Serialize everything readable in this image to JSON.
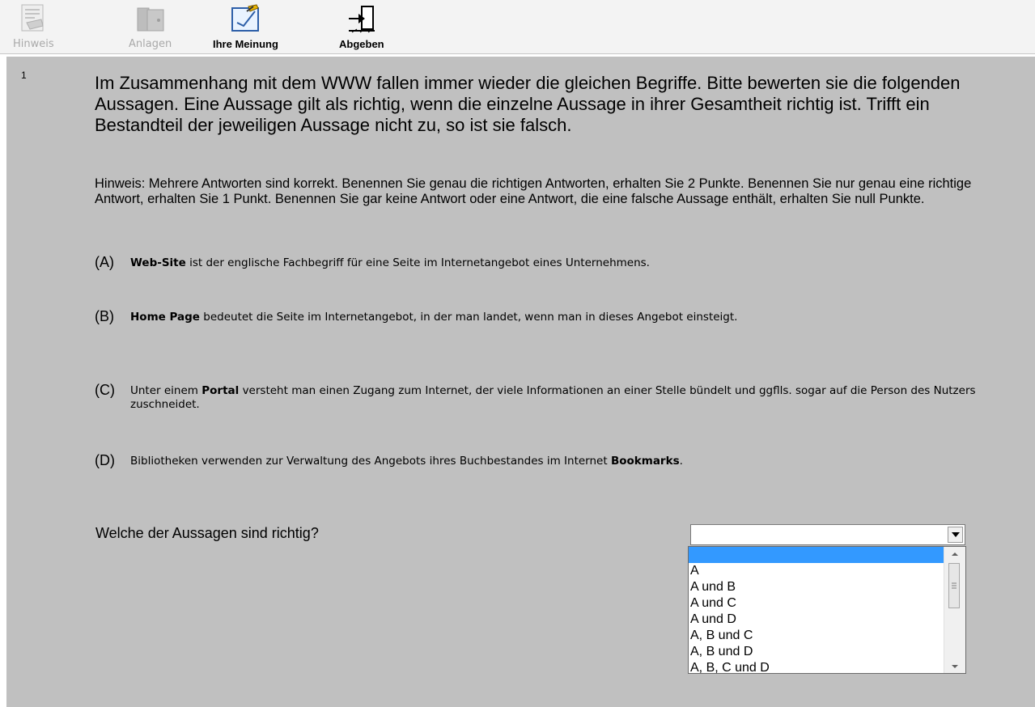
{
  "toolbar": {
    "items": [
      {
        "label": "Hinweis",
        "icon": "hint-document-icon",
        "enabled": false
      },
      {
        "label": "Anlagen",
        "icon": "attachments-folder-icon",
        "enabled": false
      },
      {
        "label": "Ihre Meinung",
        "icon": "feedback-pencil-icon",
        "enabled": true
      },
      {
        "label": "Abgeben",
        "icon": "exit-door-icon",
        "enabled": true
      }
    ]
  },
  "question": {
    "number": "1",
    "text": "Im Zusammenhang mit dem WWW fallen immer wieder die gleichen Begriffe. Bitte bewerten sie die folgenden Aussagen. Eine Aussage gilt als richtig, wenn die einzelne Aussage in ihrer Gesamtheit richtig ist. Trifft ein Bestandteil der jeweiligen Aussage nicht zu, so ist sie falsch.",
    "hint": "Hinweis: Mehrere Antworten sind korrekt. Benennen Sie genau die richtigen Antworten, erhalten Sie 2 Punkte. Benennen Sie nur genau eine richtige Antwort, erhalten Sie 1 Punkt. Benennen Sie gar keine Antwort oder eine Antwort, die eine falsche Aussage enthält, erhalten Sie null Punkte."
  },
  "options": [
    {
      "letter": "(A)",
      "pre": "",
      "bold": "Web-Site",
      "post": " ist der englische Fachbegriff für eine Seite im Internetangebot eines Unternehmens."
    },
    {
      "letter": "(B)",
      "pre": "",
      "bold": "Home Page",
      "post": " bedeutet die Seite im Internetangebot, in der man landet, wenn man in dieses Angebot einsteigt."
    },
    {
      "letter": "(C)",
      "pre": "Unter einem ",
      "bold": "Portal",
      "post": " versteht man einen Zugang zum Internet, der viele Informationen an einer Stelle bündelt und ggflls. sogar auf die Person des Nutzers zuschneidet."
    },
    {
      "letter": "(D)",
      "pre": "Bibliotheken verwenden zur Verwaltung des Angebots ihres Buchbestandes im Internet ",
      "bold": "Bookmarks",
      "post": "."
    }
  ],
  "answer": {
    "prompt": "Welche der  Aussagen sind richtig?",
    "selected_value": "",
    "dropdown_options": [
      "",
      "A",
      "A und B",
      "A und C",
      "A und D",
      "A, B und C",
      "A, B und D",
      "A, B, C und D"
    ]
  },
  "colors": {
    "panel_bg": "#c0c0c0",
    "toolbar_bg": "#f3f3f3",
    "selection": "#3399ff"
  }
}
